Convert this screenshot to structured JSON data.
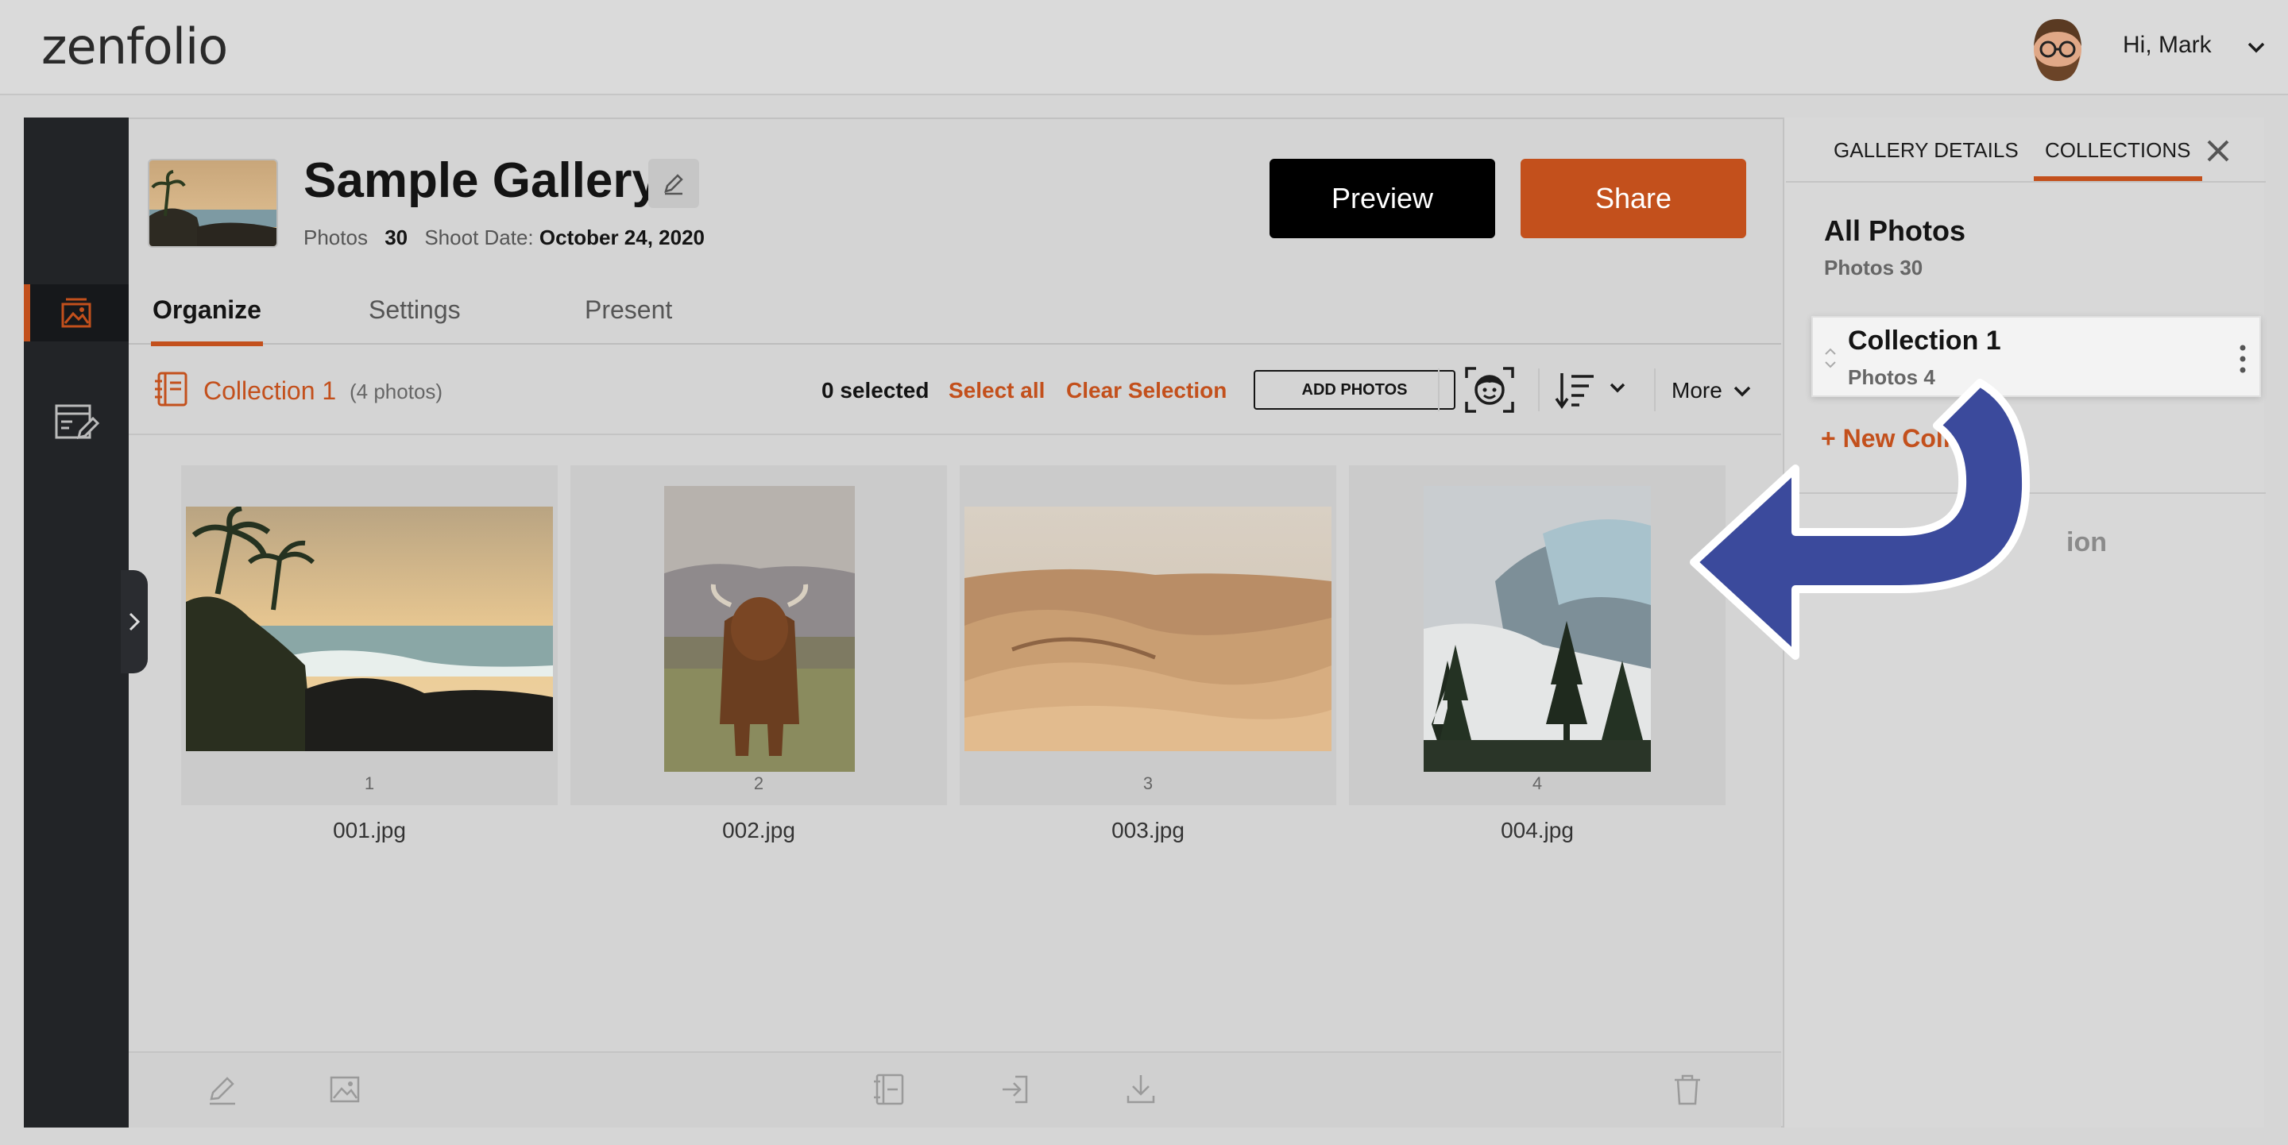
{
  "brand": {
    "logo_text": "zenfolio"
  },
  "user": {
    "greeting": "Hi, Mark"
  },
  "gallery": {
    "title": "Sample Gallery",
    "photos_label": "Photos",
    "photos_count": "30",
    "shoot_date_label": "Shoot Date:",
    "shoot_date": "October 24, 2020",
    "preview_label": "Preview",
    "share_label": "Share"
  },
  "tabs": [
    {
      "label": "Organize",
      "active": true
    },
    {
      "label": "Settings",
      "active": false
    },
    {
      "label": "Present",
      "active": false
    }
  ],
  "toolbar": {
    "collection_name": "Collection 1",
    "collection_count": "(4 photos)",
    "selected": "0 selected",
    "select_all": "Select all",
    "clear_selection": "Clear Selection",
    "add_photos": "ADD PHOTOS",
    "more": "More"
  },
  "photos": [
    {
      "number": "1",
      "file": "001.jpg"
    },
    {
      "number": "2",
      "file": "002.jpg"
    },
    {
      "number": "3",
      "file": "003.jpg"
    },
    {
      "number": "4",
      "file": "004.jpg"
    }
  ],
  "right_panel": {
    "tabs": [
      {
        "label": "GALLERY DETAILS",
        "active": false
      },
      {
        "label": "COLLECTIONS",
        "active": true
      }
    ],
    "all_photos_title": "All Photos",
    "all_photos_count": "Photos 30",
    "collection_title": "Collection 1",
    "collection_count": "Photos 4",
    "new_collection_visible": "+ New Collec",
    "hidden_fragment": "ion"
  },
  "colors": {
    "accent": "#c3501c",
    "nav_bg": "#222427",
    "arrow": "#3b4a9c"
  }
}
